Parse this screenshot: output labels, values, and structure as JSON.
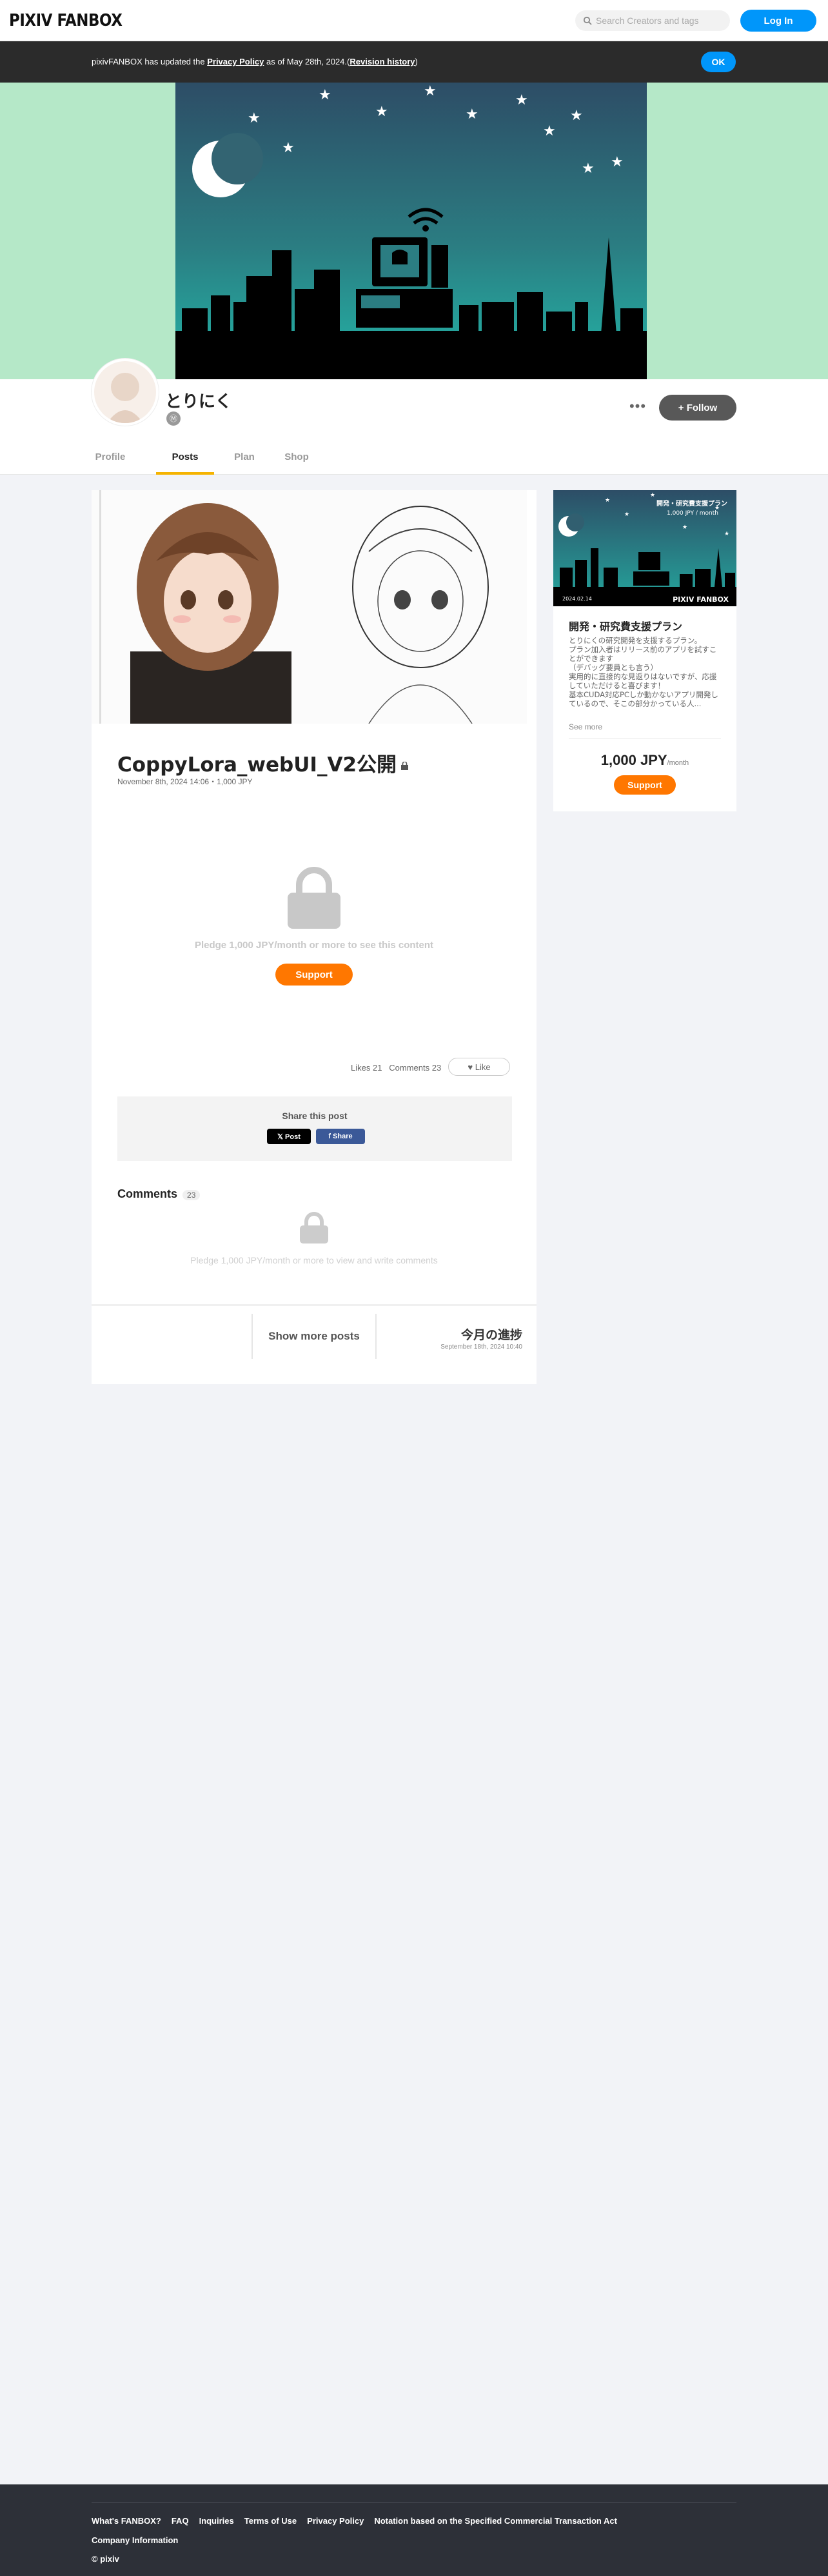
{
  "header": {
    "logo": "PIXIV FANBOX",
    "search_placeholder": "Search Creators and tags",
    "login_label": "Log In"
  },
  "notice": {
    "prefix": "pixivFANBOX has updated the ",
    "link": "Privacy Policy",
    "middle": " as of May 28th, 2024.(",
    "history_link": "Revision history",
    "suffix": ")",
    "ok_label": "OK"
  },
  "creator": {
    "name": "とりにく",
    "badge": "Ⓜ",
    "more_label": "•••",
    "follow_label": "+ Follow"
  },
  "tabs": [
    {
      "label": "Profile",
      "active": false
    },
    {
      "label": "Posts",
      "active": true
    },
    {
      "label": "Plan",
      "active": false
    },
    {
      "label": "Shop",
      "active": false
    }
  ],
  "post": {
    "title": "CoppyLora_webUI_V2公開",
    "meta": "November 8th, 2024 14:06・1,000 JPY",
    "pledge_text": "Pledge 1,000 JPY/month or more to see this content",
    "support_label": "Support",
    "likes": "Likes 21",
    "comments": "Comments 23",
    "like_label": "Like",
    "share_title": "Share this post",
    "x_label": "𝕏 Post",
    "fb_label": "f Share",
    "comments_heading": "Comments",
    "comments_count": "23",
    "pledge_comments": "Pledge 1,000 JPY/month or more to view and write comments",
    "show_more": "Show more posts",
    "next_title": "今月の進捗",
    "next_date": "September 18th, 2024 10:40"
  },
  "plan": {
    "banner_title": "開発・研究費支援プラン",
    "banner_price": "1,000 JPY / month",
    "banner_date": "2024.02.14",
    "banner_brand": "PIXIV FANBOX",
    "title": "開発・研究費支援プラン",
    "description": "とりにくの研究開発を支援するプラン。\nプラン加入者はリリース前のアプリを試すことができます\n（デバッグ要員とも言う）\n実用的に直接的な見返りはないですが、応援していただけると喜びます！\n基本CUDA対応PCしか動かないアプリ開発しているので、そこの部分かっている人...",
    "see_more": "See more",
    "price": "1,000 JPY",
    "price_unit": "/month",
    "support_label": "Support"
  },
  "footer": {
    "links": [
      "What's FANBOX?",
      "FAQ",
      "Inquiries",
      "Terms of Use",
      "Privacy Policy",
      "Notation based on the Specified Commercial Transaction Act",
      "Company Information"
    ],
    "copyright": "© pixiv"
  },
  "colors": {
    "accent_blue": "#0096fa",
    "support_orange": "#ff7700",
    "tab_underline": "#f5b300",
    "cover_green": "#b5e8c8"
  }
}
